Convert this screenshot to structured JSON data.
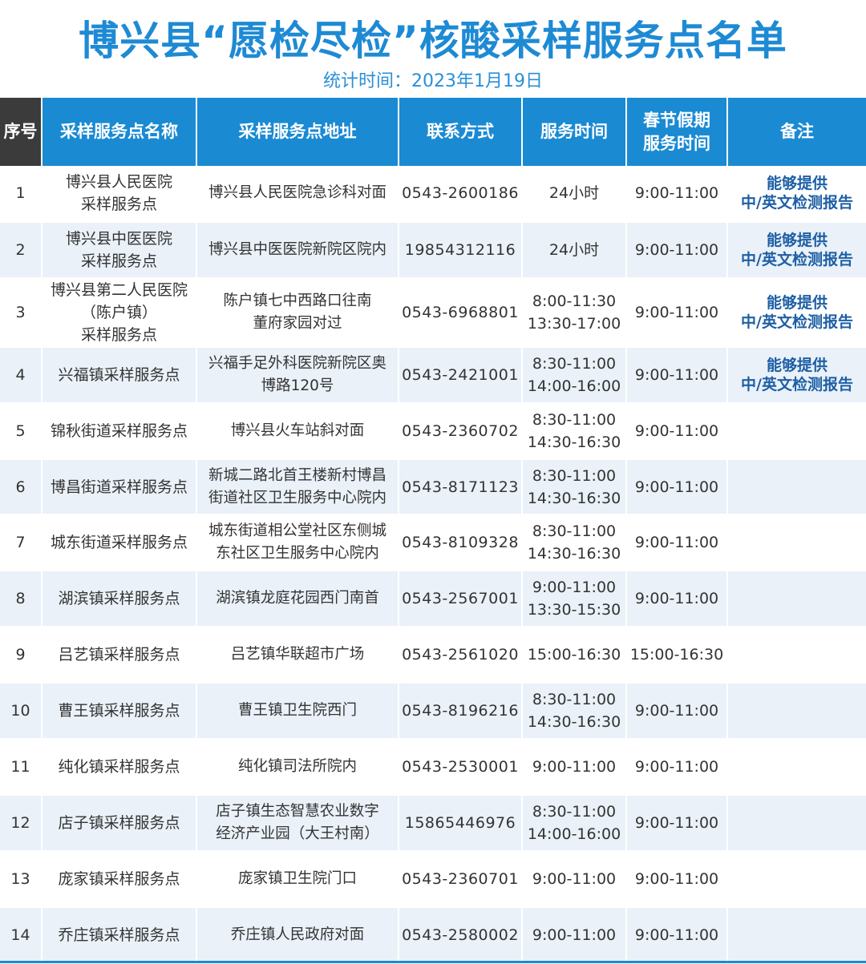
{
  "title": "博兴县“愿检尽检”核酸采样服务点名单",
  "subtitle": "统计时间：2023年1月19日",
  "colors": {
    "header_bg": "#1a8ad3",
    "title": "#1e8ad4",
    "note": "#1d5fa5",
    "row_alt": "#eaf1f8"
  },
  "headers": {
    "no": "序号",
    "name": "采样服务点名称",
    "address": "采样服务点地址",
    "phone": "联系方式",
    "time": "服务时间",
    "holiday": [
      "春节假期",
      "服务时间"
    ],
    "note": "备注"
  },
  "rows": [
    {
      "no": "1",
      "name": [
        "博兴县人民医院",
        "采样服务点"
      ],
      "address": [
        "博兴县人民医院急诊科对面"
      ],
      "phone": "0543-2600186",
      "time": [
        "24小时"
      ],
      "holiday": "9:00-11:00",
      "note": [
        "能够提供",
        "中/英文检测报告"
      ]
    },
    {
      "no": "2",
      "name": [
        "博兴县中医医院",
        "采样服务点"
      ],
      "address": [
        "博兴县中医医院新院区院内"
      ],
      "phone": "19854312116",
      "time": [
        "24小时"
      ],
      "holiday": "9:00-11:00",
      "note": [
        "能够提供",
        "中/英文检测报告"
      ]
    },
    {
      "no": "3",
      "name": [
        "博兴县第二人民医院",
        "（陈户镇）",
        "采样服务点"
      ],
      "address": [
        "陈户镇七中西路口往南",
        "董府家园对过"
      ],
      "phone": "0543-6968801",
      "time": [
        "8:00-11:30",
        "13:30-17:00"
      ],
      "holiday": "9:00-11:00",
      "note": [
        "能够提供",
        "中/英文检测报告"
      ]
    },
    {
      "no": "4",
      "name": [
        "兴福镇采样服务点"
      ],
      "address": [
        "兴福手足外科医院新院区奥",
        "博路120号"
      ],
      "phone": "0543-2421001",
      "time": [
        "8:30-11:00",
        "14:00-16:00"
      ],
      "holiday": "9:00-11:00",
      "note": [
        "能够提供",
        "中/英文检测报告"
      ]
    },
    {
      "no": "5",
      "name": [
        "锦秋街道采样服务点"
      ],
      "address": [
        "博兴县火车站斜对面"
      ],
      "phone": "0543-2360702",
      "time": [
        "8:30-11:00",
        "14:30-16:30"
      ],
      "holiday": "9:00-11:00",
      "note": []
    },
    {
      "no": "6",
      "name": [
        "博昌街道采样服务点"
      ],
      "address": [
        "新城二路北首王楼新村博昌",
        "街道社区卫生服务中心院内"
      ],
      "phone": "0543-8171123",
      "time": [
        "8:30-11:00",
        "14:30-16:30"
      ],
      "holiday": "9:00-11:00",
      "note": []
    },
    {
      "no": "7",
      "name": [
        "城东街道采样服务点"
      ],
      "address": [
        "城东街道相公堂社区东侧城",
        "东社区卫生服务中心院内"
      ],
      "phone": "0543-8109328",
      "time": [
        "8:30-11:00",
        "14:30-16:30"
      ],
      "holiday": "9:00-11:00",
      "note": []
    },
    {
      "no": "8",
      "name": [
        "湖滨镇采样服务点"
      ],
      "address": [
        "湖滨镇龙庭花园西门南首"
      ],
      "phone": "0543-2567001",
      "time": [
        "9:00-11:00",
        "13:30-15:30"
      ],
      "holiday": "9:00-11:00",
      "note": []
    },
    {
      "no": "9",
      "name": [
        "吕艺镇采样服务点"
      ],
      "address": [
        "吕艺镇华联超市广场"
      ],
      "phone": "0543-2561020",
      "time": [
        "15:00-16:30"
      ],
      "holiday": "15:00-16:30",
      "note": []
    },
    {
      "no": "10",
      "name": [
        "曹王镇采样服务点"
      ],
      "address": [
        "曹王镇卫生院西门"
      ],
      "phone": "0543-8196216",
      "time": [
        "8:30-11:00",
        "14:30-16:30"
      ],
      "holiday": "9:00-11:00",
      "note": []
    },
    {
      "no": "11",
      "name": [
        "纯化镇采样服务点"
      ],
      "address": [
        "纯化镇司法所院内"
      ],
      "phone": "0543-2530001",
      "time": [
        "9:00-11:00"
      ],
      "holiday": "9:00-11:00",
      "note": []
    },
    {
      "no": "12",
      "name": [
        "店子镇采样服务点"
      ],
      "address": [
        "店子镇生态智慧农业数字",
        "经济产业园（大王村南）"
      ],
      "phone": "15865446976",
      "time": [
        "8:30-11:00",
        "14:00-16:00"
      ],
      "holiday": "9:00-11:00",
      "note": []
    },
    {
      "no": "13",
      "name": [
        "庞家镇采样服务点"
      ],
      "address": [
        "庞家镇卫生院门口"
      ],
      "phone": "0543-2360701",
      "time": [
        "9:00-11:00"
      ],
      "holiday": "9:00-11:00",
      "note": []
    },
    {
      "no": "14",
      "name": [
        "乔庄镇采样服务点"
      ],
      "address": [
        "乔庄镇人民政府对面"
      ],
      "phone": "0543-2580002",
      "time": [
        "9:00-11:00"
      ],
      "holiday": "9:00-11:00",
      "note": []
    }
  ]
}
